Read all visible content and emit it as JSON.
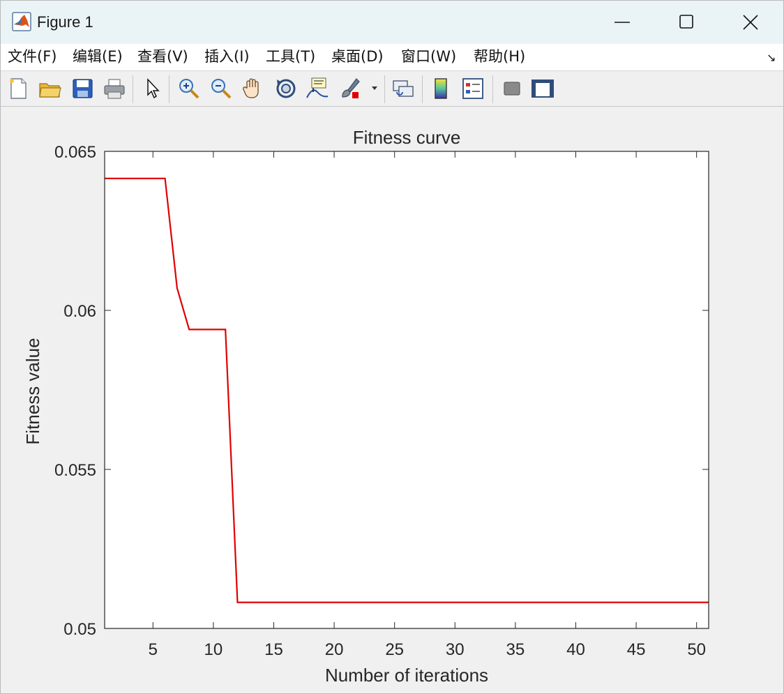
{
  "window": {
    "title": "Figure 1",
    "controls": {
      "minimize": "minimize",
      "maximize": "maximize",
      "close": "close"
    }
  },
  "menu": {
    "items": [
      {
        "label": "文件(F)"
      },
      {
        "label": "编辑(E)"
      },
      {
        "label": "查看(V)"
      },
      {
        "label": "插入(I)"
      },
      {
        "label": "工具(T)"
      },
      {
        "label": "桌面(D)"
      },
      {
        "label": "窗口(W)"
      },
      {
        "label": "帮助(H)"
      }
    ]
  },
  "toolbar": {
    "buttons": [
      {
        "icon": "new-figure-icon"
      },
      {
        "icon": "open-file-icon"
      },
      {
        "icon": "save-icon"
      },
      {
        "icon": "print-icon"
      },
      {
        "icon": "edit-plot-pointer-icon"
      },
      {
        "icon": "zoom-in-icon"
      },
      {
        "icon": "zoom-out-icon"
      },
      {
        "icon": "pan-hand-icon"
      },
      {
        "icon": "rotate-3d-icon"
      },
      {
        "icon": "data-cursor-icon"
      },
      {
        "icon": "brush-icon"
      },
      {
        "icon": "link-plot-icon"
      },
      {
        "icon": "insert-colorbar-icon"
      },
      {
        "icon": "insert-legend-icon"
      },
      {
        "icon": "hide-plot-tools-icon"
      },
      {
        "icon": "show-plot-tools-icon"
      }
    ]
  },
  "chart_data": {
    "type": "line",
    "title": "Fitness curve",
    "xlabel": "Number of iterations",
    "ylabel": "Fitness value",
    "xlim": [
      1,
      51
    ],
    "ylim": [
      0.05,
      0.065
    ],
    "xticks": [
      5,
      10,
      15,
      20,
      25,
      30,
      35,
      40,
      45,
      50
    ],
    "xtick_labels": [
      "5",
      "10",
      "15",
      "20",
      "25",
      "30",
      "35",
      "40",
      "45",
      "50"
    ],
    "yticks": [
      0.05,
      0.055,
      0.06,
      0.065
    ],
    "ytick_labels": [
      "0.05",
      "0.055",
      "0.06",
      "0.065"
    ],
    "grid": false,
    "series": [
      {
        "color": "#e00000",
        "x": [
          1,
          2,
          3,
          4,
          5,
          6,
          7,
          8,
          9,
          10,
          11,
          12,
          13,
          14,
          15,
          16,
          17,
          18,
          19,
          20,
          21,
          22,
          23,
          24,
          25,
          26,
          27,
          28,
          29,
          30,
          31,
          32,
          33,
          34,
          35,
          36,
          37,
          38,
          39,
          40,
          41,
          42,
          43,
          44,
          45,
          46,
          47,
          48,
          49,
          50,
          51
        ],
        "y": [
          0.06415,
          0.06415,
          0.06415,
          0.06415,
          0.06415,
          0.06415,
          0.0607,
          0.0594,
          0.0594,
          0.0594,
          0.0594,
          0.05082,
          0.05082,
          0.05082,
          0.05082,
          0.05082,
          0.05082,
          0.05082,
          0.05082,
          0.05082,
          0.05082,
          0.05082,
          0.05082,
          0.05082,
          0.05082,
          0.05082,
          0.05082,
          0.05082,
          0.05082,
          0.05082,
          0.05082,
          0.05082,
          0.05082,
          0.05082,
          0.05082,
          0.05082,
          0.05082,
          0.05082,
          0.05082,
          0.05082,
          0.05082,
          0.05082,
          0.05082,
          0.05082,
          0.05082,
          0.05082,
          0.05082,
          0.05082,
          0.05082,
          0.05082,
          0.05082
        ]
      }
    ]
  }
}
